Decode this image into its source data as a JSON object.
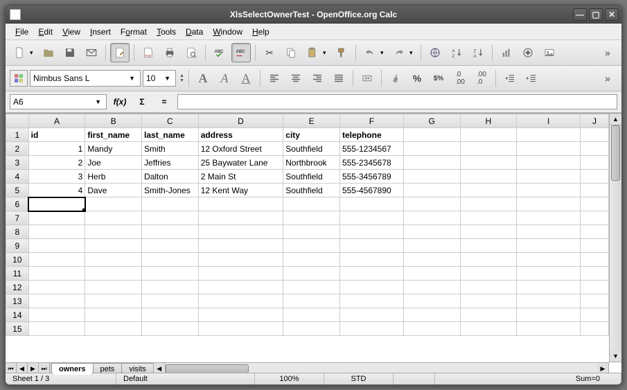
{
  "window": {
    "title": "XlsSelectOwnerTest - OpenOffice.org Calc"
  },
  "menu": {
    "file": "File",
    "edit": "Edit",
    "view": "View",
    "insert": "Insert",
    "format": "Format",
    "tools": "Tools",
    "data": "Data",
    "window": "Window",
    "help": "Help"
  },
  "format_bar": {
    "font_name": "Nimbus Sans L",
    "font_size": "10"
  },
  "namebox": {
    "ref": "A6"
  },
  "formula_bar": {
    "value": ""
  },
  "columns": [
    "A",
    "B",
    "C",
    "D",
    "E",
    "F",
    "G",
    "H",
    "I",
    "J"
  ],
  "row_count": 15,
  "active_cell": {
    "row": 6,
    "col": 0
  },
  "headers": {
    "A": "id",
    "B": "first_name",
    "C": "last_name",
    "D": "address",
    "E": "city",
    "F": "telephone"
  },
  "rows": [
    {
      "A": "1",
      "B": "Mandy",
      "C": "Smith",
      "D": "12 Oxford Street",
      "E": "Southfield",
      "F": "555-1234567"
    },
    {
      "A": "2",
      "B": "Joe",
      "C": "Jeffries",
      "D": "25 Baywater Lane",
      "E": "Northbrook",
      "F": "555-2345678"
    },
    {
      "A": "3",
      "B": "Herb",
      "C": "Dalton",
      "D": "2 Main St",
      "E": "Southfield",
      "F": "555-3456789"
    },
    {
      "A": "4",
      "B": "Dave",
      "C": "Smith-Jones",
      "D": "12 Kent Way",
      "E": "Southfield",
      "F": "555-4567890"
    }
  ],
  "col_widths": {
    "A": 80,
    "B": 80,
    "C": 80,
    "D": 120,
    "E": 80,
    "F": 90,
    "G": 80,
    "H": 80,
    "I": 90,
    "J": 40
  },
  "sheet_tabs": {
    "active": "owners",
    "tabs": [
      "owners",
      "pets",
      "visits"
    ]
  },
  "status": {
    "sheet": "Sheet 1 / 3",
    "style": "Default",
    "zoom": "100%",
    "mode": "STD",
    "sum": "Sum=0"
  }
}
